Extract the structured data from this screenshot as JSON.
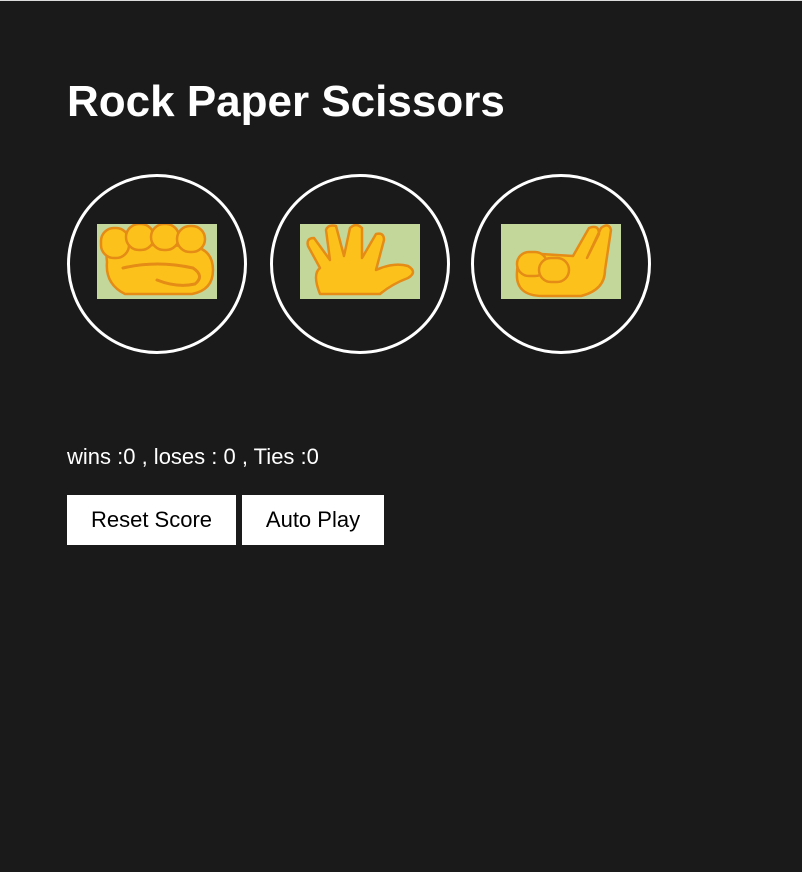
{
  "title": "Rock Paper Scissors",
  "moves": [
    {
      "name": "rock",
      "icon": "fist-hand-icon"
    },
    {
      "name": "paper",
      "icon": "open-hand-icon"
    },
    {
      "name": "scissors",
      "icon": "victory-hand-icon"
    }
  ],
  "score": {
    "text": "wins :0 , loses : 0 , Ties :0"
  },
  "buttons": {
    "reset": "Reset Score",
    "auto_play": "Auto Play"
  },
  "colors": {
    "background": "#1a1a1a",
    "foreground": "#ffffff",
    "icon_background": "#c3d79b",
    "hand_yellow": "#fcc21b",
    "hand_outline": "#e48c15"
  }
}
